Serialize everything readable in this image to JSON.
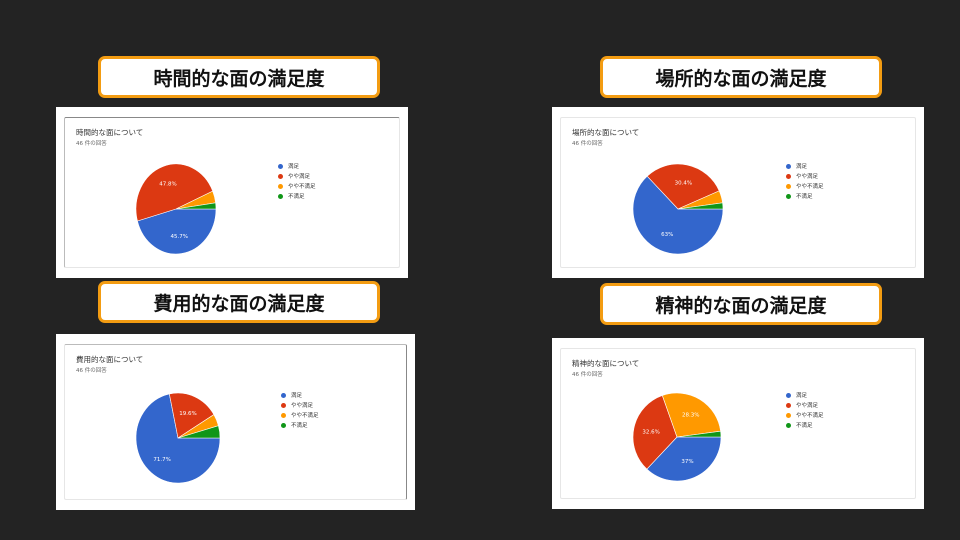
{
  "colors": {
    "satisfied": "#3366cc",
    "somewhat_satisfied": "#dc3912",
    "somewhat_dissatisfied": "#ff9900",
    "dissatisfied": "#109618"
  },
  "panels": [
    {
      "banner": "時間的な面の満足度",
      "title": "時間的な面について",
      "subtitle": "46 件の回答"
    },
    {
      "banner": "場所的な面の満足度",
      "title": "場所的な面について",
      "subtitle": "46 件の回答"
    },
    {
      "banner": "費用的な面の満足度",
      "title": "費用的な面について",
      "subtitle": "46 件の回答"
    },
    {
      "banner": "精神的な面の満足度",
      "title": "精神的な面について",
      "subtitle": "46 件の回答"
    }
  ],
  "chart_data": [
    {
      "type": "pie",
      "title": "時間的な面について",
      "categories": [
        "満足",
        "やや満足",
        "やや不満足",
        "不満足"
      ],
      "values": [
        45.7,
        47.8,
        4.3,
        2.2
      ],
      "slice_labels": [
        "45.7%",
        "47.8%",
        "",
        ""
      ],
      "legend": "right"
    },
    {
      "type": "pie",
      "title": "場所的な面について",
      "categories": [
        "満足",
        "やや満足",
        "やや不満足",
        "不満足"
      ],
      "values": [
        63,
        30.4,
        4.4,
        2.2
      ],
      "slice_labels": [
        "63%",
        "30.4%",
        "",
        ""
      ],
      "legend": "right"
    },
    {
      "type": "pie",
      "title": "費用的な面について",
      "categories": [
        "満足",
        "やや満足",
        "やや不満足",
        "不満足"
      ],
      "values": [
        71.7,
        19.6,
        4.3,
        4.4
      ],
      "slice_labels": [
        "71.7%",
        "19.6%",
        "",
        ""
      ],
      "legend": "right"
    },
    {
      "type": "pie",
      "title": "精神的な面について",
      "categories": [
        "満足",
        "やや満足",
        "やや不満足",
        "不満足"
      ],
      "values": [
        37,
        32.6,
        28.3,
        2.1
      ],
      "slice_labels": [
        "37%",
        "32.6%",
        "28.3%",
        ""
      ],
      "legend": "right"
    }
  ]
}
